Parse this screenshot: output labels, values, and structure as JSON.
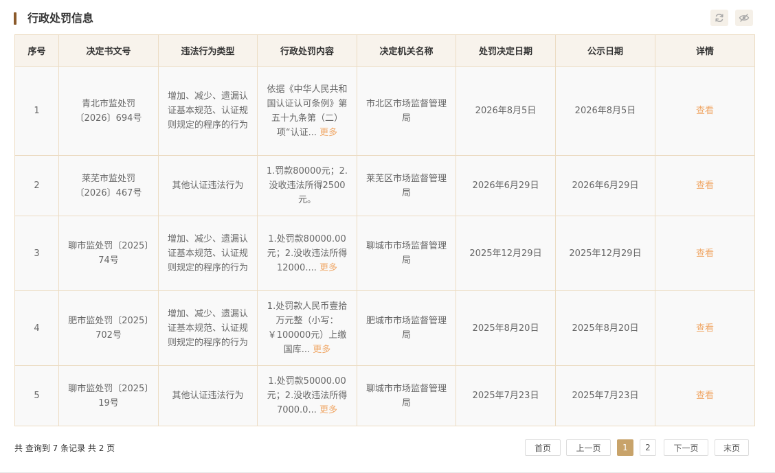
{
  "panel": {
    "title": "行政处罚信息"
  },
  "header_icons": {
    "refresh": "refresh-icon",
    "visibility": "eye-icon",
    "color": "#a8a8a8"
  },
  "table": {
    "columns": [
      "序号",
      "决定书文号",
      "违法行为类型",
      "行政处罚内容",
      "决定机关名称",
      "处罚决定日期",
      "公示日期",
      "详情"
    ],
    "rows": [
      {
        "index": "1",
        "doc_no": "青北市监处罚〔2026〕694号",
        "violation": "增加、减少、遗漏认证基本规范、认证规则规定的程序的行为",
        "content": "依据《中华人民共和国认证认可条例》第五十九条第（二）项“认证...",
        "content_more": "更多",
        "authority": "市北区市场监督管理局",
        "decision_date": "2026年8月5日",
        "publish_date": "2026年8月5日",
        "detail": "查看"
      },
      {
        "index": "2",
        "doc_no": "莱芜市监处罚〔2026〕467号",
        "violation": "其他认证违法行为",
        "content": "1.罚款80000元；2.没收违法所得2500元。",
        "content_more": "",
        "authority": "莱芜区市场监督管理局",
        "decision_date": "2026年6月29日",
        "publish_date": "2026年6月29日",
        "detail": "查看"
      },
      {
        "index": "3",
        "doc_no": "聊市监处罚〔2025〕74号",
        "violation": "增加、减少、遗漏认证基本规范、认证规则规定的程序的行为",
        "content": "1.处罚款80000.00元；2.没收违法所得12000....",
        "content_more": "更多",
        "authority": "聊城市市场监督管理局",
        "decision_date": "2025年12月29日",
        "publish_date": "2025年12月29日",
        "detail": "查看"
      },
      {
        "index": "4",
        "doc_no": "肥市监处罚〔2025〕702号",
        "violation": "增加、减少、遗漏认证基本规范、认证规则规定的程序的行为",
        "content": "1.处罚款人民币壹拾万元整（小写：￥100000元）上缴国库...",
        "content_more": "更多",
        "authority": "肥城市市场监督管理局",
        "decision_date": "2025年8月20日",
        "publish_date": "2025年8月20日",
        "detail": "查看"
      },
      {
        "index": "5",
        "doc_no": "聊市监处罚〔2025〕19号",
        "violation": "其他认证违法行为",
        "content": "1.处罚款50000.00元；2.没收违法所得7000.0...",
        "content_more": "更多",
        "authority": "聊城市市场监督管理局",
        "decision_date": "2025年7月23日",
        "publish_date": "2025年7月23日",
        "detail": "查看"
      }
    ]
  },
  "footer": {
    "summary": "共 查询到 7 条记录 共 2 页",
    "pagination": {
      "first": "首页",
      "prev": "上一页",
      "pages": [
        "1",
        "2"
      ],
      "current_page": "1",
      "next": "下一页",
      "last": "末页"
    }
  },
  "colors": {
    "accent_bar": "#8b5a2b",
    "header_bg": "#f8f3ec",
    "border": "#ecdcc3",
    "link": "#f0a868",
    "active_page": "#c8a36a"
  }
}
